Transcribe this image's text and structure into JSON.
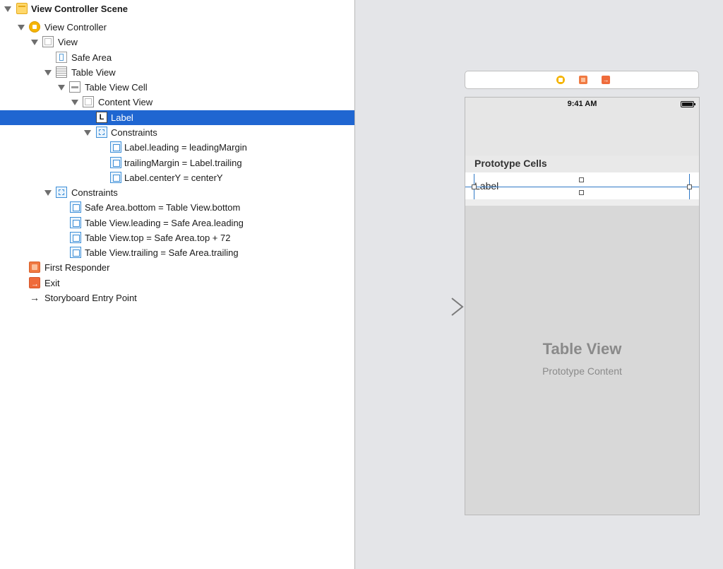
{
  "outline": {
    "rows": [
      {
        "label": "View Controller Scene",
        "icon": "scene-icon",
        "expanded": true
      },
      {
        "label": "View Controller",
        "icon": "view-controller-icon",
        "expanded": true
      },
      {
        "label": "View",
        "icon": "view-icon",
        "expanded": true
      },
      {
        "label": "Safe Area",
        "icon": "safe-area-icon"
      },
      {
        "label": "Table View",
        "icon": "table-view-icon",
        "expanded": true
      },
      {
        "label": "Table View Cell",
        "icon": "table-view-cell-icon",
        "expanded": true
      },
      {
        "label": "Content View",
        "icon": "view-icon",
        "expanded": true
      },
      {
        "label": "Label",
        "icon": "label-icon",
        "selected": true,
        "glyph": "L"
      },
      {
        "label": "Constraints",
        "icon": "constraints-icon",
        "expanded": true
      },
      {
        "label": "Label.leading = leadingMargin",
        "icon": "constraint-icon"
      },
      {
        "label": "trailingMargin = Label.trailing",
        "icon": "constraint-icon"
      },
      {
        "label": "Label.centerY = centerY",
        "icon": "constraint-icon"
      },
      {
        "label": "Constraints",
        "icon": "constraints-icon",
        "expanded": true
      },
      {
        "label": "Safe Area.bottom = Table View.bottom",
        "icon": "constraint-icon"
      },
      {
        "label": "Table View.leading = Safe Area.leading",
        "icon": "constraint-icon"
      },
      {
        "label": "Table View.top = Safe Area.top + 72",
        "icon": "constraint-icon"
      },
      {
        "label": "Table View.trailing = Safe Area.trailing",
        "icon": "constraint-icon"
      },
      {
        "label": "First Responder",
        "icon": "first-responder-icon"
      },
      {
        "label": "Exit",
        "icon": "exit-icon"
      },
      {
        "label": "Storyboard Entry Point",
        "icon": "arrow-right-icon",
        "glyph": "→"
      }
    ]
  },
  "canvas": {
    "dock_icons": [
      "view-controller-icon",
      "first-responder-icon",
      "exit-icon"
    ],
    "status_time": "9:41 AM",
    "prototype_cells_title": "Prototype Cells",
    "cell_label": "Label",
    "table_view_title": "Table View",
    "table_view_subtitle": "Prototype Content"
  },
  "colors": {
    "selection": "#1f66d1",
    "constraint_guide": "#2f78c6",
    "canvas_background": "#e4e5e8"
  }
}
